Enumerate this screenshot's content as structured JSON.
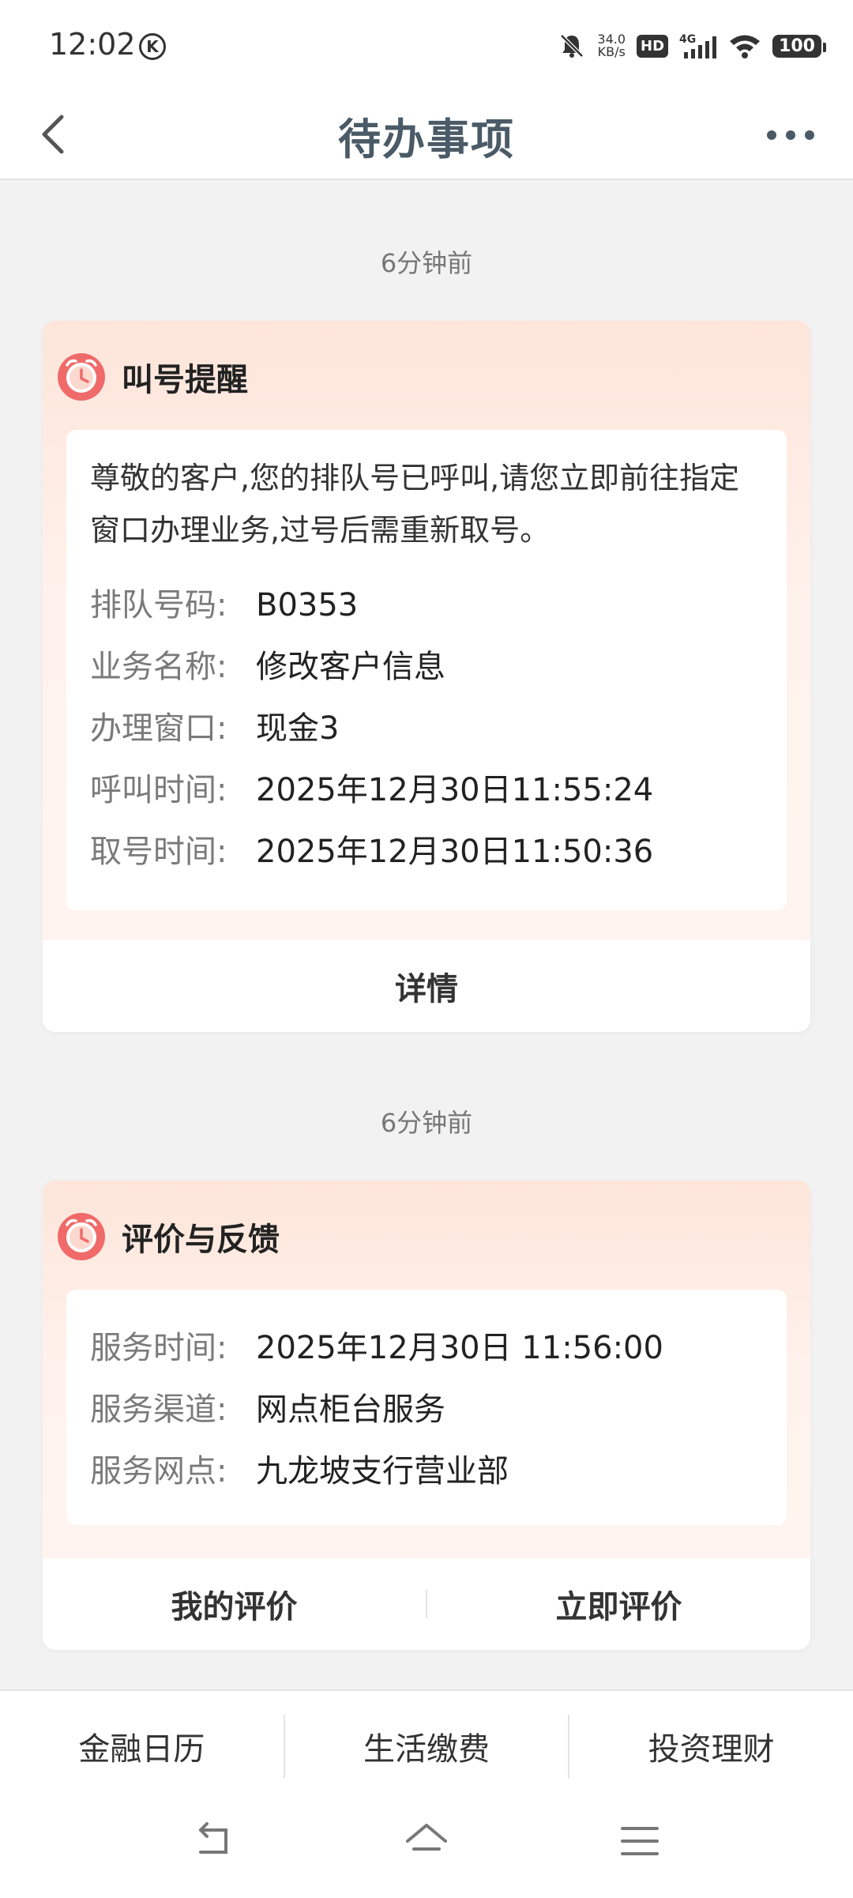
{
  "status_bar": {
    "time": "12:02",
    "k_badge": "K",
    "net_speed_value": "34.0",
    "net_speed_unit": "KB/s",
    "hd": "HD",
    "network": "4G",
    "battery": "100"
  },
  "header": {
    "title": "待办事项"
  },
  "cards": [
    {
      "timestamp": "6分钟前",
      "title": "叫号提醒",
      "message": "尊敬的客户,您的排队号已呼叫,请您立即前往指定窗口办理业务,过号后需重新取号。",
      "rows": [
        {
          "label": "排队号码:",
          "value": "B0353"
        },
        {
          "label": "业务名称:",
          "value": "修改客户信息"
        },
        {
          "label": "办理窗口:",
          "value": "现金3"
        },
        {
          "label": "呼叫时间:",
          "value": "2025年12月30日11:55:24"
        },
        {
          "label": "取号时间:",
          "value": "2025年12月30日11:50:36"
        }
      ],
      "footer_button": "详情"
    },
    {
      "timestamp": "6分钟前",
      "title": "评价与反馈",
      "rows": [
        {
          "label": "服务时间:",
          "value": "2025年12月30日 11:56:00"
        },
        {
          "label": "服务渠道:",
          "value": "网点柜台服务"
        },
        {
          "label": "服务网点:",
          "value": "九龙坡支行营业部"
        }
      ],
      "footer_buttons": [
        "我的评价",
        "立即评价"
      ]
    }
  ],
  "bottom_tabs": [
    "金融日历",
    "生活缴费",
    "投资理财"
  ],
  "colors": {
    "accent_alarm": "#f06a6a",
    "card_gradient_top": "#fde5da",
    "title_color": "#4a5a66"
  }
}
